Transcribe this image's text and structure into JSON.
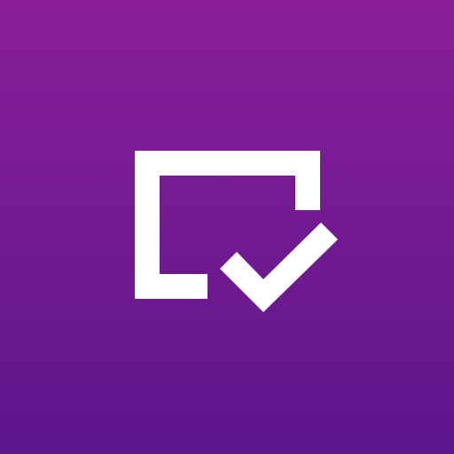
{
  "icon": {
    "name": "checked-box-logo-icon",
    "background_gradient": [
      "#8a1f98",
      "#5c168c"
    ],
    "glyph_color": "#ffffff"
  }
}
